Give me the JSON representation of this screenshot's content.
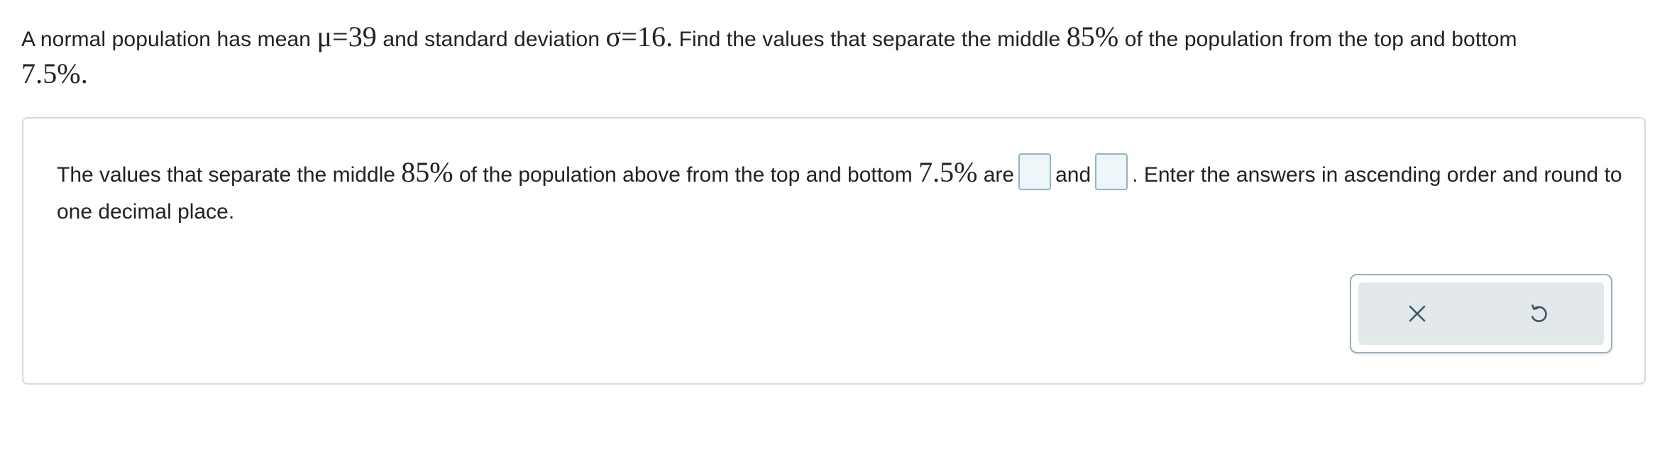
{
  "question": {
    "part1": "A normal population has mean ",
    "mu_expr": "μ=39",
    "part2": " and standard deviation ",
    "sigma_expr": "σ=16.",
    "part3": " Find the values that separate the middle ",
    "middle_pct": "85%",
    "part4": " of the population from the top and bottom ",
    "tail_pct": "7.5%."
  },
  "answer": {
    "part1": "The values that separate the middle ",
    "middle_pct": "85%",
    "part2": " of the population above from the top and bottom ",
    "tail_pct": "7.5%",
    "part3": " are",
    "and_text": "and",
    "part4": ". Enter the answers in ascending order and round to one decimal place.",
    "blank1_value": "",
    "blank2_value": ""
  },
  "controls": {
    "clear_icon": "x-icon",
    "reset_icon": "undo-icon"
  },
  "colors": {
    "icon": "#3b5664",
    "blank_border": "#8fb6c6",
    "blank_fill": "#eef6fa",
    "button_bg": "#e3e8eb"
  }
}
